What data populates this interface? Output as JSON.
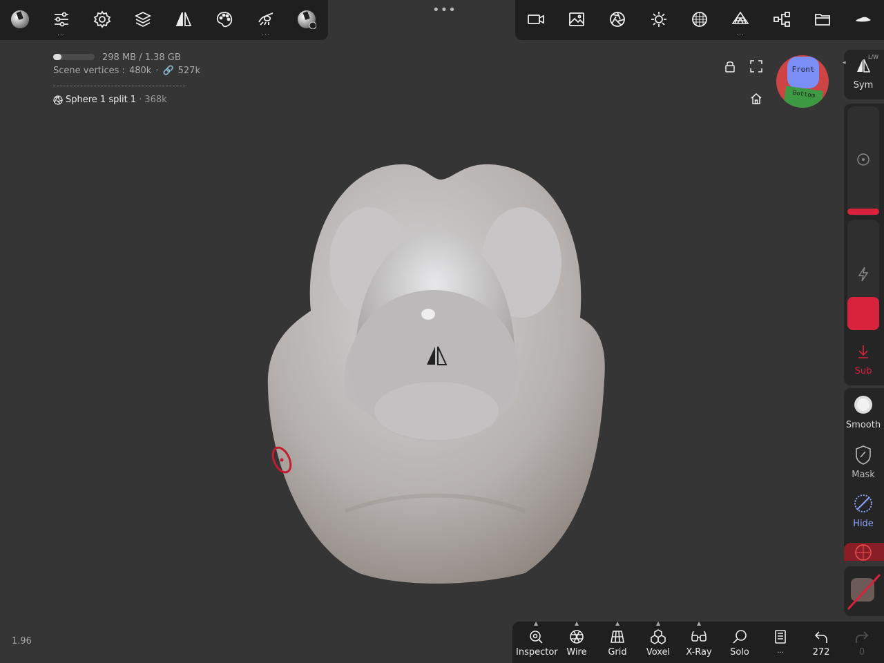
{
  "top_left_toolbar": [
    {
      "name": "nomad-logo-icon"
    },
    {
      "name": "sliders-icon"
    },
    {
      "name": "gear-icon"
    },
    {
      "name": "layers-icon"
    },
    {
      "name": "symmetry-icon"
    },
    {
      "name": "palette-icon"
    },
    {
      "name": "stroke-icon"
    },
    {
      "name": "material-icon"
    }
  ],
  "top_right_toolbar": [
    {
      "name": "camera-icon"
    },
    {
      "name": "image-icon"
    },
    {
      "name": "aperture-icon"
    },
    {
      "name": "sun-icon"
    },
    {
      "name": "shading-icon"
    },
    {
      "name": "multires-icon"
    },
    {
      "name": "share-icon"
    },
    {
      "name": "folder-icon"
    },
    {
      "name": "hat-icon"
    }
  ],
  "more_dots": "•••",
  "stats": {
    "memory": "298 MB / 1.38 GB",
    "memory_used_fraction": 0.2,
    "vertices_label": "Scene vertices :",
    "vertices": "480k",
    "linked": "527k"
  },
  "selected_object": {
    "name": "Sphere 1 split 1",
    "count": "· 368k"
  },
  "gizmo": {
    "front": "Front",
    "bottom": "Bottom"
  },
  "right_panel": {
    "sym": "Sym",
    "sym_sub": "L/W",
    "sub": "Sub",
    "smooth": "Smooth",
    "mask": "Mask",
    "hide": "Hide",
    "accent_color": "#d9233d"
  },
  "bottom_bar": [
    {
      "label": "Inspector",
      "icon": "eye-icon"
    },
    {
      "label": "Wire",
      "icon": "wire-icon"
    },
    {
      "label": "Grid",
      "icon": "grid-icon"
    },
    {
      "label": "Voxel",
      "icon": "voxel-icon"
    },
    {
      "label": "X-Ray",
      "icon": "xray-icon"
    },
    {
      "label": "Solo",
      "icon": "search-icon"
    },
    {
      "label": "...",
      "icon": "book-icon"
    },
    {
      "label": "272",
      "icon": "undo-icon"
    },
    {
      "label": "0",
      "icon": "redo-icon"
    }
  ],
  "zoom_readout": "1.96"
}
